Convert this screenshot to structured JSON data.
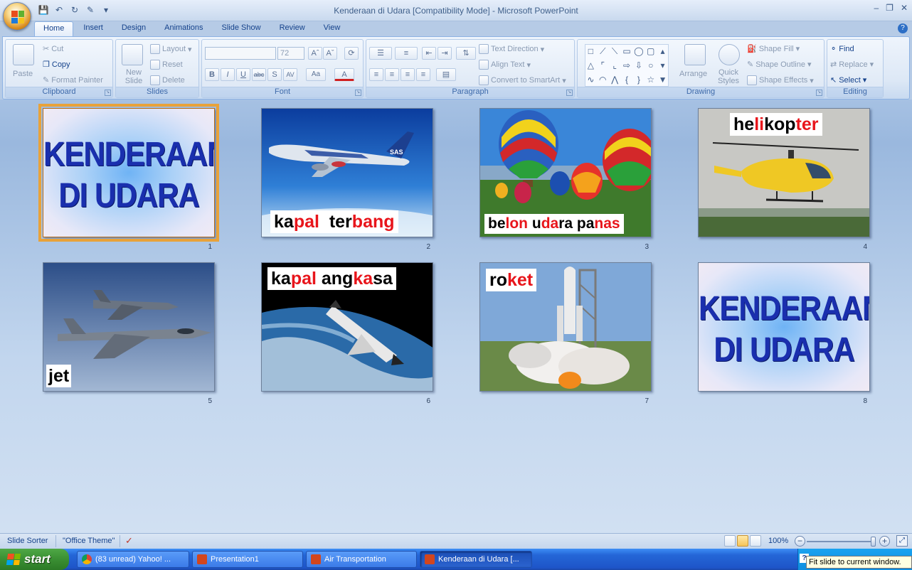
{
  "window": {
    "title": "Kenderaan di Udara [Compatibility Mode] - Microsoft PowerPoint"
  },
  "ribbon": {
    "tabs": [
      "Home",
      "Insert",
      "Design",
      "Animations",
      "Slide Show",
      "Review",
      "View"
    ],
    "active_tab": "Home",
    "clipboard": {
      "paste": "Paste",
      "cut": "Cut",
      "copy": "Copy",
      "format_painter": "Format Painter",
      "label": "Clipboard"
    },
    "slides": {
      "new_slide": "New Slide",
      "layout": "Layout",
      "reset": "Reset",
      "delete": "Delete",
      "label": "Slides"
    },
    "font": {
      "size": "72",
      "label": "Font"
    },
    "paragraph": {
      "text_direction": "Text Direction",
      "align_text": "Align Text",
      "convert_smartart": "Convert to SmartArt",
      "label": "Paragraph"
    },
    "drawing": {
      "arrange": "Arrange",
      "quick_styles": "Quick Styles",
      "shape_fill": "Shape Fill",
      "shape_outline": "Shape Outline",
      "shape_effects": "Shape Effects",
      "label": "Drawing"
    },
    "editing": {
      "find": "Find",
      "replace": "Replace",
      "select": "Select",
      "label": "Editing"
    }
  },
  "slides": [
    {
      "number": "1",
      "kind": "title",
      "line1": "KENDERAAN",
      "line2": "DI  UDARA",
      "selected": true
    },
    {
      "number": "2",
      "kind": "photo",
      "subject": "airplane",
      "caption_parts": [
        [
          "ka",
          "k"
        ],
        [
          "pal",
          "r"
        ],
        [
          "  ter",
          "k"
        ],
        [
          "bang",
          "r"
        ]
      ]
    },
    {
      "number": "3",
      "kind": "photo",
      "subject": "hot-air-balloons",
      "caption_parts": [
        [
          "be",
          "k"
        ],
        [
          "lon",
          "r"
        ],
        [
          " u",
          "k"
        ],
        [
          "da",
          "r"
        ],
        [
          "ra pa",
          "k"
        ],
        [
          "nas",
          "r"
        ]
      ]
    },
    {
      "number": "4",
      "kind": "photo",
      "subject": "helicopter",
      "caption_parts": [
        [
          "he",
          "k"
        ],
        [
          "li",
          "r"
        ],
        [
          "kop",
          "k"
        ],
        [
          "ter",
          "r"
        ]
      ]
    },
    {
      "number": "5",
      "kind": "photo",
      "subject": "fighter-jets",
      "caption_parts": [
        [
          "jet",
          "k"
        ]
      ]
    },
    {
      "number": "6",
      "kind": "photo",
      "subject": "space-shuttle",
      "caption_parts": [
        [
          "ka",
          "k"
        ],
        [
          "pal",
          "r"
        ],
        [
          " ang",
          "k"
        ],
        [
          "ka",
          "r"
        ],
        [
          "sa",
          "k"
        ]
      ]
    },
    {
      "number": "7",
      "kind": "photo",
      "subject": "rocket-launch",
      "caption_parts": [
        [
          "ro",
          "k"
        ],
        [
          "ket",
          "r"
        ]
      ]
    },
    {
      "number": "8",
      "kind": "title",
      "line1": "KENDERAAN",
      "line2": "DI  UDARA",
      "selected": false
    }
  ],
  "statusbar": {
    "view": "Slide Sorter",
    "theme": "\"Office Theme\"",
    "zoom": "100%"
  },
  "taskbar": {
    "start": "start",
    "items": [
      {
        "label": "(83 unread) Yahoo! ...",
        "icon_color": "#e8b21a"
      },
      {
        "label": "Presentation1",
        "icon_color": "#d2461e"
      },
      {
        "label": "Air Transportation",
        "icon_color": "#d2461e"
      },
      {
        "label": "Kenderaan di Udara [...",
        "icon_color": "#d2461e",
        "active": true
      }
    ]
  },
  "tooltip": "Fit slide to current window."
}
